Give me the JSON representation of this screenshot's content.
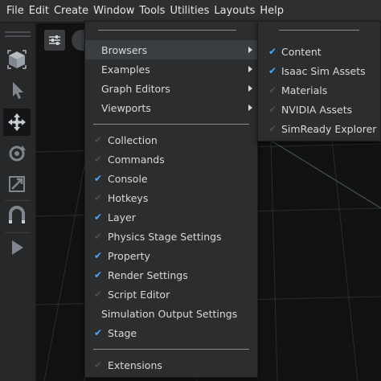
{
  "menubar": [
    "File",
    "Edit",
    "Create",
    "Window",
    "Tools",
    "Utilities",
    "Layouts",
    "Help"
  ],
  "window_menu": {
    "submenus": [
      "Browsers",
      "Examples",
      "Graph Editors",
      "Viewports"
    ],
    "items": [
      {
        "label": "Collection",
        "checked": false
      },
      {
        "label": "Commands",
        "checked": false
      },
      {
        "label": "Console",
        "checked": true
      },
      {
        "label": "Hotkeys",
        "checked": false
      },
      {
        "label": "Layer",
        "checked": true
      },
      {
        "label": "Physics Stage Settings",
        "checked": false
      },
      {
        "label": "Property",
        "checked": true
      },
      {
        "label": "Render Settings",
        "checked": true
      },
      {
        "label": "Script Editor",
        "checked": false
      },
      {
        "label": "Simulation Output Settings",
        "checked": null
      },
      {
        "label": "Stage",
        "checked": true
      }
    ],
    "footer": {
      "label": "Extensions",
      "checked": false
    }
  },
  "browsers_menu": [
    {
      "label": "Content",
      "checked": true
    },
    {
      "label": "Isaac Sim Assets",
      "checked": true
    },
    {
      "label": "Materials",
      "checked": false
    },
    {
      "label": "NVIDIA Assets",
      "checked": false
    },
    {
      "label": "SimReady Explorer",
      "checked": false
    }
  ],
  "colors": {
    "accent": "#4aa8ff",
    "menu_bg": "#2b2d2f",
    "menubar_bg": "#2d2f31",
    "viewport_bg": "#121213"
  },
  "icons": [
    "cube-icon",
    "select-arrow-icon",
    "move-icon",
    "rotate-icon",
    "scale-icon",
    "snap-magnet-icon",
    "play-icon",
    "settings-sliders-icon"
  ]
}
